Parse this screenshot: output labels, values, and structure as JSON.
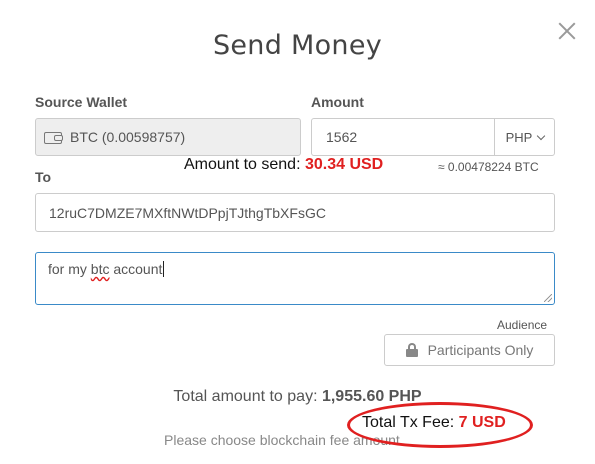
{
  "dialog": {
    "title": "Send Money",
    "close_icon": "close-icon"
  },
  "source_wallet": {
    "label": "Source Wallet",
    "value": "BTC (0.00598757)",
    "icon": "wallet-icon"
  },
  "amount": {
    "label": "Amount",
    "value": "1562",
    "currency": "PHP",
    "btc_equivalent": "≈ 0.00478224 BTC"
  },
  "annotation_send": {
    "prefix": "Amount to send: ",
    "value": "30.34 USD"
  },
  "to": {
    "label": "To",
    "value": "12ruC7DMZE7MXftNWtDPpjTJthgTbXFsGC"
  },
  "memo": {
    "pre": "for my ",
    "misspelled": "btc",
    "post": " account"
  },
  "audience": {
    "label": "Audience",
    "value": "Participants Only",
    "icon": "lock-icon"
  },
  "total": {
    "prefix": "Total amount to pay: ",
    "value": "1,955.60 PHP"
  },
  "annotation_fee": {
    "prefix": "Total Tx Fee: ",
    "value": "7 USD",
    "color": "#e02020"
  },
  "fee_hint": "Please choose blockchain fee amount"
}
